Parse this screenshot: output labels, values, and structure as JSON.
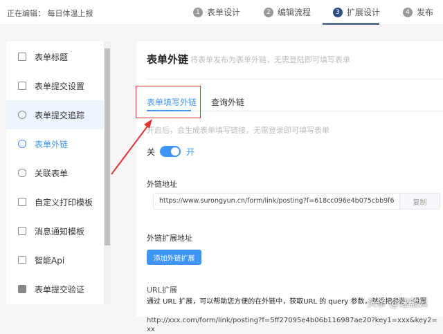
{
  "header": {
    "editing_label": "正在编辑：",
    "form_name": "每日体温上报",
    "steps": [
      {
        "num": "1",
        "label": "表单设计"
      },
      {
        "num": "2",
        "label": "编辑流程"
      },
      {
        "num": "3",
        "label": "扩展设计"
      },
      {
        "num": "4",
        "label": "发布"
      }
    ]
  },
  "sidebar": {
    "items": [
      {
        "label": "表单标题",
        "icon": "document-icon"
      },
      {
        "label": "表单提交设置",
        "icon": "file-plus-icon"
      },
      {
        "label": "表单提交追踪",
        "icon": "eye-icon"
      },
      {
        "label": "表单外链",
        "icon": "link-icon"
      },
      {
        "label": "关联表单",
        "icon": "relation-icon"
      },
      {
        "label": "自定义打印模板",
        "icon": "printer-icon"
      },
      {
        "label": "消息通知模板",
        "icon": "message-icon"
      },
      {
        "label": "智能Api",
        "icon": "chart-board-icon"
      },
      {
        "label": "表单提交验证",
        "icon": "stamp-icon"
      }
    ]
  },
  "main": {
    "title": "表单外链",
    "subtitle": "将表单发布为表单外链，无需登陆即可填写表单",
    "tabs": [
      {
        "label": "表单填写外链"
      },
      {
        "label": "查询外链"
      }
    ],
    "hint": "开启后，会生成表单填写链接，无需登录即可填写表单",
    "switch": {
      "off_label": "关",
      "on_label": "开",
      "enabled": true
    },
    "link_label": "外链地址",
    "link_value": "https://www.surongyun.cn/form/link/posting?f=618cc096e4b075cbb9f6",
    "copy_label": "复制",
    "ext_label": "外链扩展地址",
    "ext_button": "添加外链扩展",
    "url_ext_label": "URL扩展",
    "url_ext_desc": "通过 URL 扩展，可以帮助您方便的在外链中，获取URL 的 query 参数，然后把参数，设置",
    "url_ext_example": "http://xxx.com/form/link/posting?f=5ff27095e4b06b116987ae20?key1=xxx&key2=xx"
  },
  "watermark": "头条 @速融云"
}
